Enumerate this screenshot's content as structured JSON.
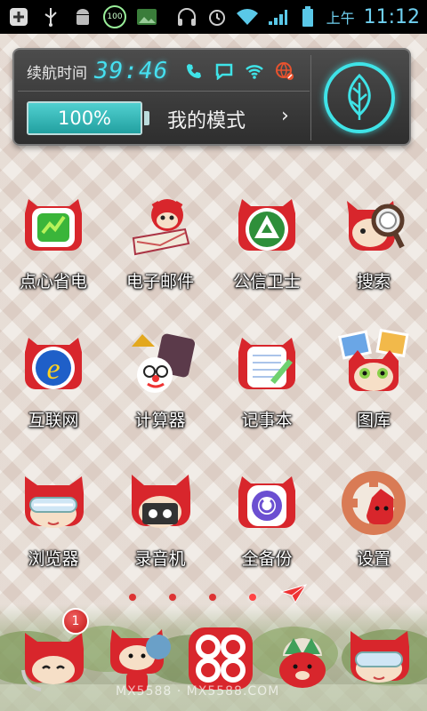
{
  "status_bar": {
    "icons_left": [
      "add-icon",
      "usb-icon",
      "android-icon",
      "battery-saver-100-icon",
      "image-icon"
    ],
    "badge_text": "100",
    "icons_right": [
      "headphones-icon",
      "alarm-icon",
      "wifi-icon",
      "signal-icon",
      "battery-icon"
    ],
    "time_prefix": "上午",
    "time": "11:12"
  },
  "widget": {
    "duration_label": "续航时间",
    "duration_value": "39:46",
    "toggles": [
      "phone-icon",
      "message-icon",
      "wifi-icon",
      "network-off-icon"
    ],
    "battery_level": 1.0,
    "battery_text": "100%",
    "mode_label": "我的模式",
    "mode_arrow": "›",
    "leaf_icon": "leaf-icon",
    "accent_color": "#3fe3e7"
  },
  "apps": [
    {
      "label": "点心省电",
      "icon": "battery-saver-icon"
    },
    {
      "label": "电子邮件",
      "icon": "email-icon"
    },
    {
      "label": "公信卫士",
      "icon": "security-guard-icon"
    },
    {
      "label": "搜索",
      "icon": "search-icon"
    },
    {
      "label": "互联网",
      "icon": "browser-e-icon"
    },
    {
      "label": "计算器",
      "icon": "calculator-icon"
    },
    {
      "label": "记事本",
      "icon": "notepad-icon"
    },
    {
      "label": "图库",
      "icon": "gallery-icon"
    },
    {
      "label": "浏览器",
      "icon": "browser-icon"
    },
    {
      "label": "录音机",
      "icon": "recorder-icon"
    },
    {
      "label": "全备份",
      "icon": "backup-icon"
    },
    {
      "label": "设置",
      "icon": "settings-icon"
    }
  ],
  "page_indicator": {
    "count": 4,
    "current": 4
  },
  "dock": {
    "apps": [
      {
        "icon": "phone-fox-icon"
      },
      {
        "icon": "contacts-fox-icon"
      },
      {
        "icon": "app-drawer-icon"
      },
      {
        "icon": "messages-icon"
      },
      {
        "icon": "browser-fox-icon"
      }
    ],
    "badge_count": "1"
  },
  "watermark": "MX5588 · MX5588.COM",
  "colors": {
    "fox_red": "#d8262c",
    "status_accent": "#6fd0f0"
  }
}
